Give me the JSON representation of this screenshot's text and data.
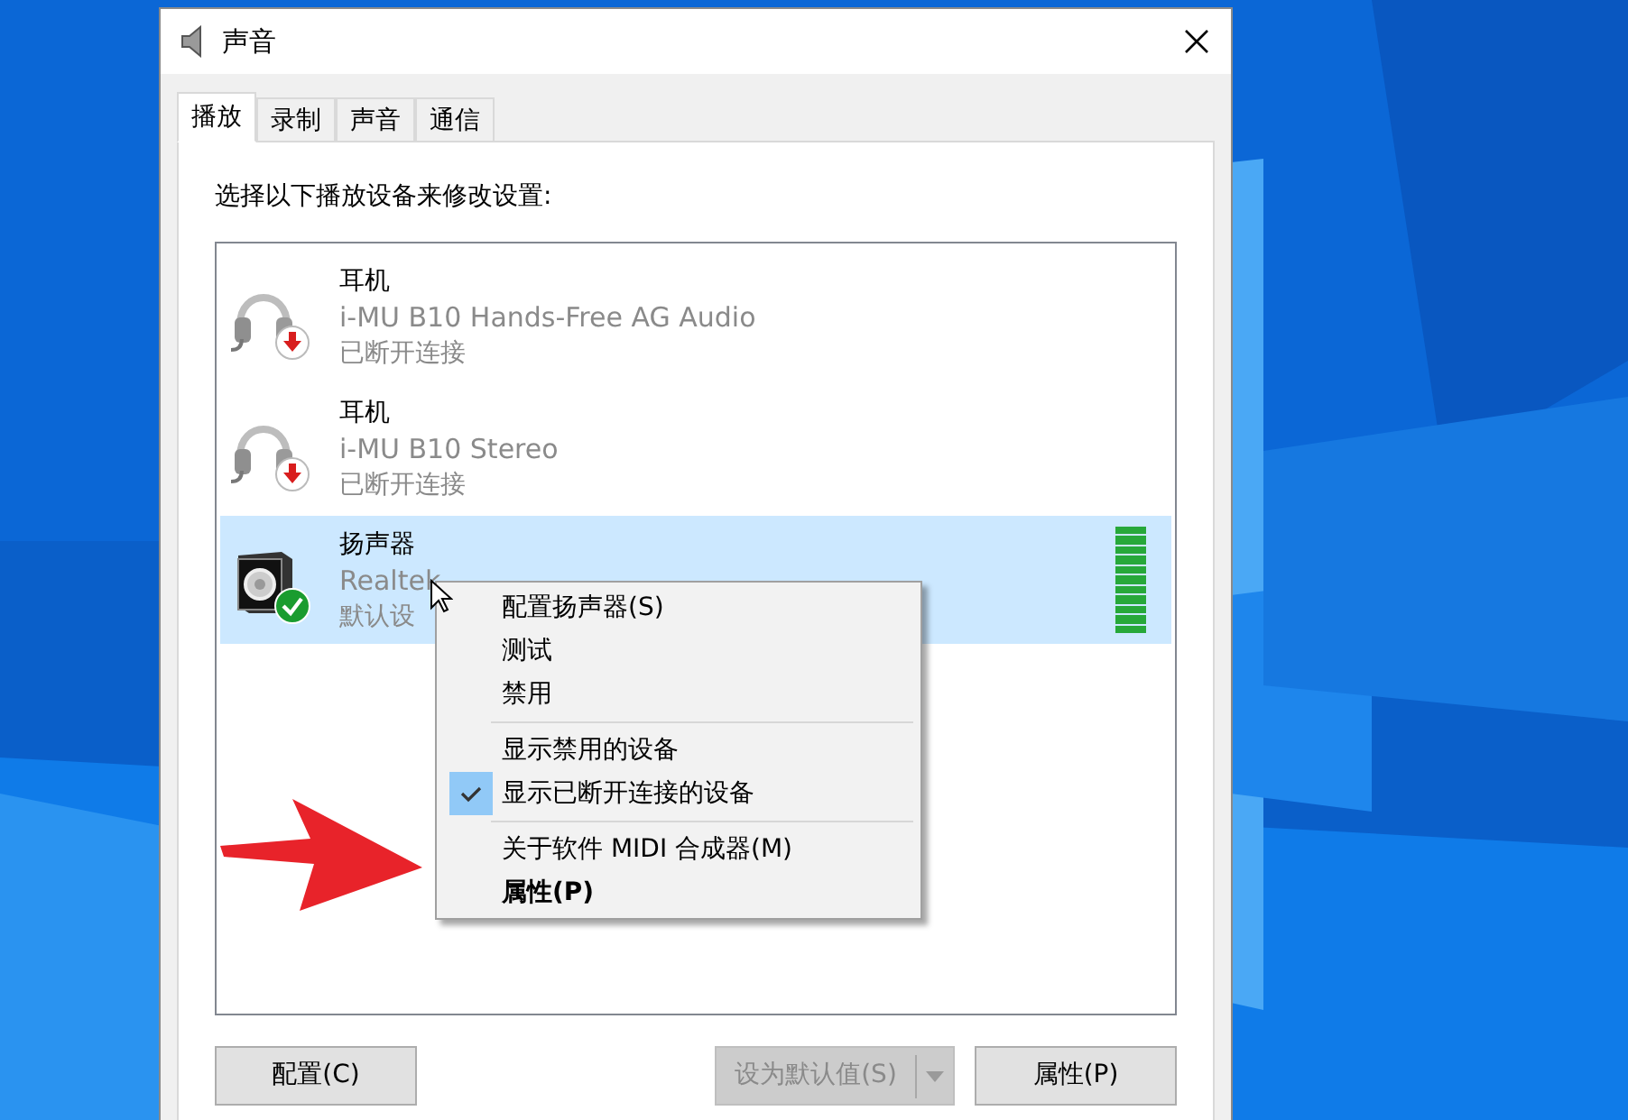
{
  "window": {
    "title": "声音"
  },
  "tabs": [
    {
      "label": "播放",
      "selected": true
    },
    {
      "label": "录制",
      "selected": false
    },
    {
      "label": "声音",
      "selected": false
    },
    {
      "label": "通信",
      "selected": false
    }
  ],
  "instruction": "选择以下播放设备来修改设置:",
  "devices": [
    {
      "kind": "headset",
      "name": "耳机",
      "description": "i-MU B10 Hands-Free AG Audio",
      "status": "已断开连接",
      "default": false,
      "selected": false
    },
    {
      "kind": "headset",
      "name": "耳机",
      "description": "i-MU B10 Stereo",
      "status": "已断开连接",
      "default": false,
      "selected": false
    },
    {
      "kind": "speaker",
      "name": "扬声器",
      "description": "Realtek",
      "status": "默认设",
      "default": true,
      "selected": true,
      "level": 1
    }
  ],
  "context_menu": [
    {
      "kind": "item",
      "label": "配置扬声器(S)",
      "checked": false,
      "default": false
    },
    {
      "kind": "item",
      "label": "测试",
      "checked": false,
      "default": false
    },
    {
      "kind": "item",
      "label": "禁用",
      "checked": false,
      "default": false
    },
    {
      "kind": "separator"
    },
    {
      "kind": "item",
      "label": "显示禁用的设备",
      "checked": false,
      "default": false
    },
    {
      "kind": "item",
      "label": "显示已断开连接的设备",
      "checked": true,
      "default": false
    },
    {
      "kind": "separator"
    },
    {
      "kind": "item",
      "label": "关于软件 MIDI 合成器(M)",
      "checked": false,
      "default": false
    },
    {
      "kind": "item",
      "label": "属性(P)",
      "checked": false,
      "default": true
    }
  ],
  "buttons": [
    {
      "kind": "plain",
      "label": "配置(C)",
      "disabled": false
    },
    {
      "kind": "split",
      "label": "设为默认值(S)",
      "disabled": true
    },
    {
      "kind": "plain",
      "label": "属性(P)",
      "disabled": false
    }
  ]
}
